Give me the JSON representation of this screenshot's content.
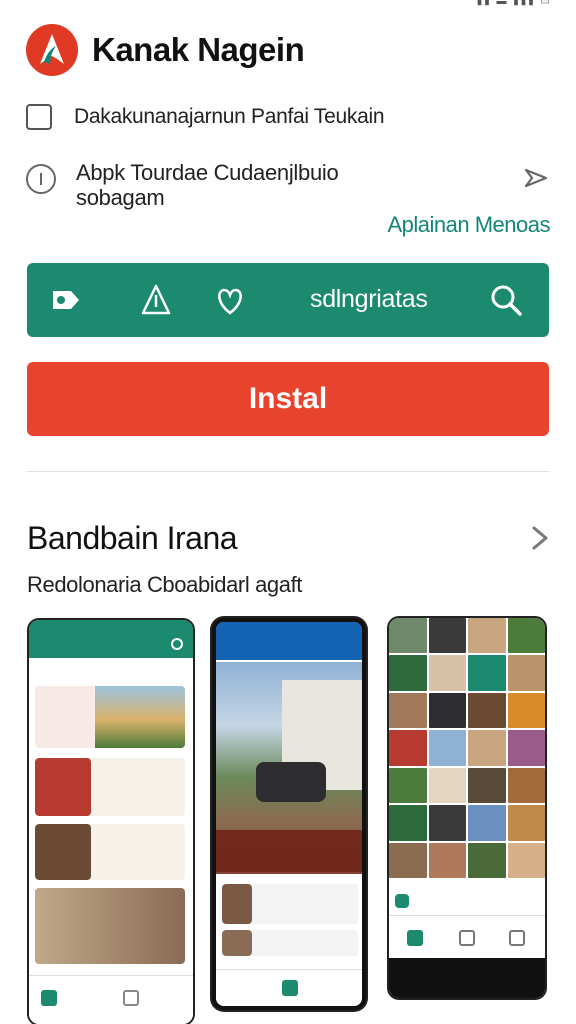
{
  "app": {
    "title": "Kanak Nagein",
    "brand_color": "#e03a24",
    "accent_color": "#1c8a6e"
  },
  "rows": {
    "checkbox_label": "Dakakunanajarnun Panfai Teukain",
    "info_text_line1": "Abpk Tourdae Cudaenjlbuio",
    "info_text_line2": "sobagam",
    "link_text": "Aplainan Menoas"
  },
  "toolbar": {
    "label": "sdlngriatas",
    "icons": [
      "video-icon",
      "warning-icon",
      "heart-icon",
      "search-icon"
    ]
  },
  "install": {
    "label": "Instal"
  },
  "section": {
    "title": "Bandbain Irana",
    "subtitle": "Redolonaria Cboabidarl agaft"
  },
  "screenshots": [
    {
      "name": "screenshot-1"
    },
    {
      "name": "screenshot-2"
    },
    {
      "name": "screenshot-3"
    }
  ]
}
